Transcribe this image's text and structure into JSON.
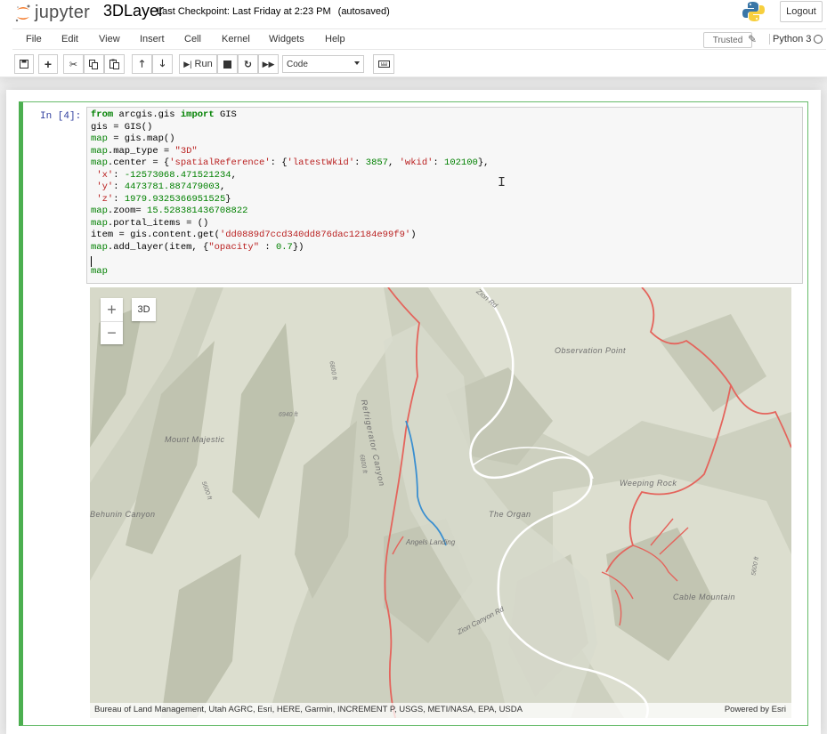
{
  "header": {
    "logo_text": "jupyter",
    "notebook_title": "3DLayer",
    "checkpoint": "Last Checkpoint: Last Friday at 2:23 PM",
    "autosave": "(autosaved)",
    "logout_label": "Logout"
  },
  "menubar": {
    "items": [
      "File",
      "Edit",
      "View",
      "Insert",
      "Cell",
      "Kernel",
      "Widgets",
      "Help"
    ],
    "trusted_label": "Trusted",
    "kernel_name": "Python 3"
  },
  "toolbar": {
    "run_label": "Run",
    "cell_type": "Code"
  },
  "cell": {
    "prompt": "In [4]:",
    "last_line": "map"
  },
  "map": {
    "btn_3d": "3D",
    "zoom_in": "+",
    "zoom_out": "−",
    "labels": {
      "refrigerator_canyon": "Refrigerator Canyon",
      "observation_point": "Observation Point",
      "mount_majestic": "Mount Majestic",
      "weeping_rock": "Weeping Rock",
      "the_organ": "The Organ",
      "behunin_canyon": "Behunin Canyon",
      "angels_landing": "Angels Landing",
      "cable_mountain": "Cable Mountain",
      "zion_canyon_rd": "Zion Canyon Rd",
      "elev_6940": "6940 ft",
      "elev_6800_a": "6800 ft",
      "elev_6800_b": "6800 ft",
      "elev_5600_a": "5600 ft",
      "elev_5600_b": "5600 ft",
      "road_top": "Zion Rd"
    },
    "attribution": "Bureau of Land Management, Utah AGRC, Esri, HERE, Garmin, INCREMENT P, USGS, METI/NASA, EPA, USDA",
    "powered_by": "Powered by Esri"
  },
  "colors": {
    "cell_border": "#4caf50",
    "trail_red": "#e4645c",
    "trail_blue": "#3a8fd0",
    "map_base": "#cfd2c2"
  }
}
